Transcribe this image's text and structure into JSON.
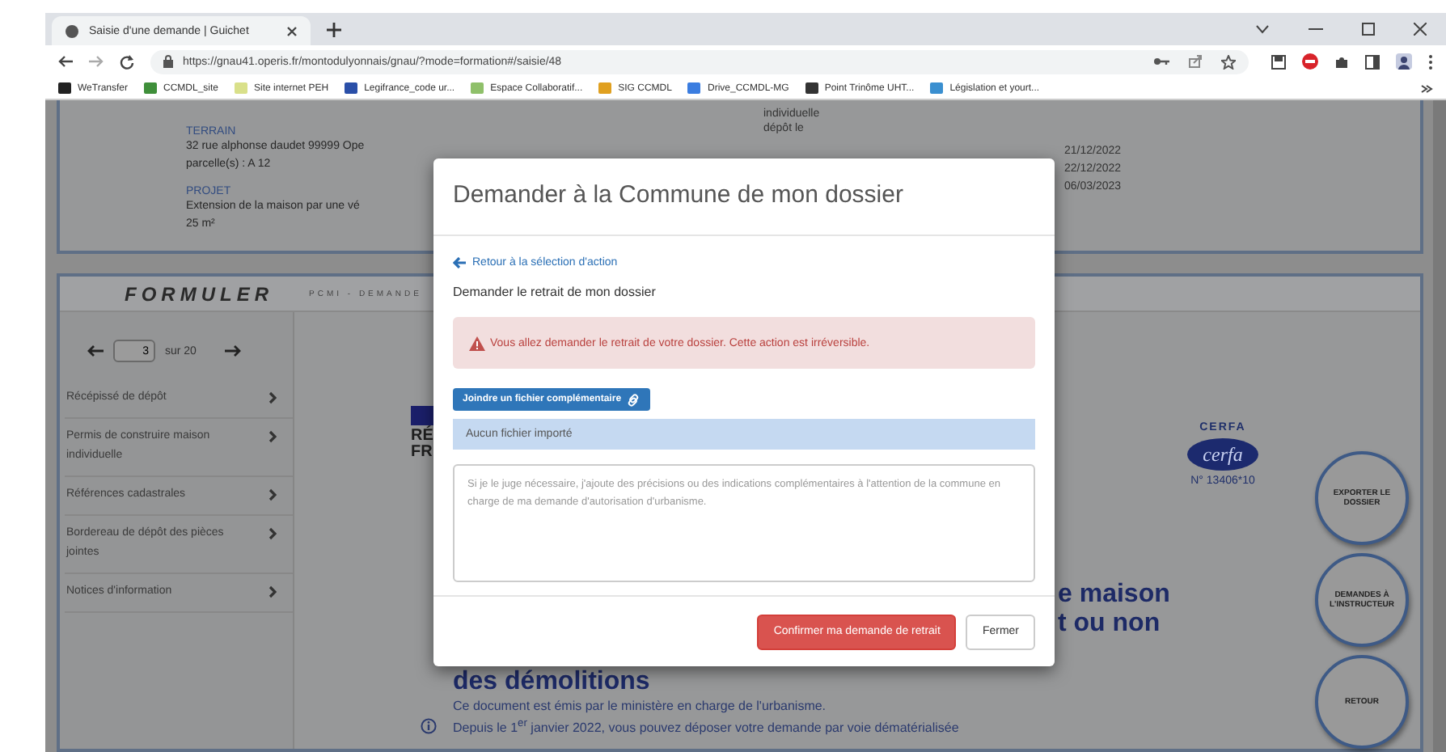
{
  "browser": {
    "tab_title": "Saisie d'une demande | Guichet",
    "url": "https://gnau41.operis.fr/montodulyonnais/gnau/?mode=formation#/saisie/48",
    "bookmarks": [
      {
        "label": "WeTransfer",
        "color": "#222222"
      },
      {
        "label": "CCMDL_site",
        "color": "#3f8f3a"
      },
      {
        "label": "Site internet PEH",
        "color": "#d9e08a"
      },
      {
        "label": "Legifrance_code ur...",
        "color": "#2a4fa8"
      },
      {
        "label": "Espace Collaboratif...",
        "color": "#8fc06a"
      },
      {
        "label": "SIG CCMDL",
        "color": "#e0a020"
      },
      {
        "label": "Drive_CCMDL-MG",
        "color": "#3b7de0"
      },
      {
        "label": "Point Trinôme UHT...",
        "color": "#333333"
      },
      {
        "label": "Législation et yourt...",
        "color": "#3a8fd0"
      }
    ]
  },
  "summary": {
    "fields": [
      {
        "label": "TERRAIN",
        "lines": [
          "32 rue alphonse daudet 99999 Ope",
          "parcelle(s) : A 12"
        ]
      },
      {
        "label": "PROJET",
        "lines": [
          "Extension de la maison par une vé",
          "25 m²"
        ]
      }
    ],
    "side_labels": [
      "individuelle",
      "dépôt le"
    ],
    "dates": [
      "21/12/2022",
      "22/12/2022",
      "06/03/2023"
    ]
  },
  "formuler": {
    "title": "FORMULER",
    "subtitle": "PCMI - DEMANDE",
    "pager": {
      "value": "3",
      "total": "sur 20"
    },
    "nav": [
      {
        "label": "Récépissé de dépôt"
      },
      {
        "label": "Permis de construire maison individuelle"
      },
      {
        "label": "Références cadastrales"
      },
      {
        "label": "Bordereau de dépôt des pièces jointes"
      },
      {
        "label": "Notices d'information"
      }
    ],
    "document": {
      "republic_lines": [
        "RÉ",
        "FR"
      ],
      "cerfa_label": "CERFA",
      "cerfa_logo": "cerfa",
      "cerfa_number": "N° 13406*10",
      "heading_lines": [
        "e maison",
        "t ou non"
      ],
      "heading_tail": "des démolitions",
      "paragraphs": [
        "Ce document est émis par le ministère en charge de l'urbanisme.",
        "Depuis le 1$^{er}$ janvier 2022, vous pouvez déposer votre demande par voie dématérialisée"
      ]
    },
    "actions": [
      "EXPORTER LE DOSSIER",
      "DEMANDES À L'INSTRUCTEUR",
      "RETOUR"
    ]
  },
  "modal": {
    "title": "Demander à la Commune de mon dossier",
    "back_link": "Retour à la sélection d'action",
    "section_title": "Demander le retrait de mon dossier",
    "alert": "Vous allez demander le retrait de votre dossier. Cette action est irréversible.",
    "attach_button": "Joindre un fichier complémentaire",
    "file_status": "Aucun fichier importé",
    "textarea": {
      "placeholder": "Si je le juge nécessaire, j'ajoute des précisions ou des indications complémentaires à l'attention de la commune en charge de ma demande d'autorisation d'urbanisme."
    },
    "buttons": [
      {
        "label": "Confirmer ma demande de retrait",
        "kind": "danger"
      },
      {
        "label": "Fermer",
        "kind": "default"
      }
    ]
  }
}
